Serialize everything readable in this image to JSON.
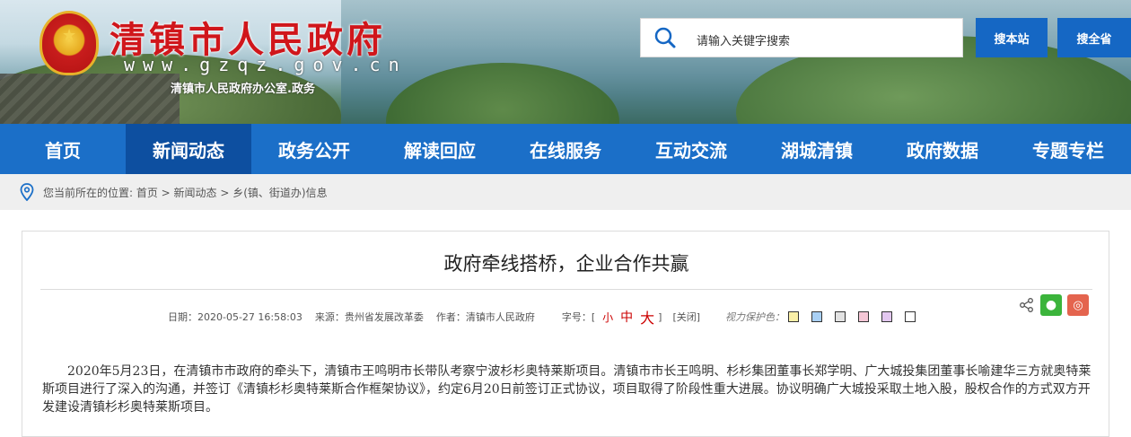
{
  "header": {
    "site_title": "清镇市人民政府",
    "site_domain": "www.gzqz.gov.cn",
    "site_org": "清镇市人民政府办公室.政务",
    "search_placeholder": "请输入关键字搜索",
    "search_station_label": "搜本站",
    "search_all_label": "搜全省"
  },
  "nav": {
    "items": [
      {
        "label": "首页"
      },
      {
        "label": "新闻动态"
      },
      {
        "label": "政务公开"
      },
      {
        "label": "解读回应"
      },
      {
        "label": "在线服务"
      },
      {
        "label": "互动交流"
      },
      {
        "label": "湖城清镇"
      },
      {
        "label": "政府数据"
      },
      {
        "label": "专题专栏"
      }
    ],
    "active_index": 1
  },
  "breadcrumb": {
    "text": "您当前所在的位置: 首页 > 新闻动态 > 乡(镇、街道办)信息"
  },
  "article": {
    "title": "政府牵线搭桥，企业合作共赢",
    "date": "日期：2020-05-27 16:58:03",
    "source": "来源：贵州省发展改革委",
    "author": "作者：清镇市人民政府",
    "font_size_label": "字号：[",
    "font_small": "小",
    "font_mid": "中",
    "font_big": "大",
    "font_close": "]",
    "close_label": "[关闭]",
    "eye_protect_label": "视力保护色：",
    "swatches": [
      "#fbf0a8",
      "#a9d0f5",
      "#e2e2e2",
      "#f5c7d6",
      "#e3c8f0",
      "#ffffff"
    ],
    "body": "2020年5月23日，在清镇市市政府的牵头下，清镇市王鸣明市长带队考察宁波杉杉奥特莱斯项目。清镇市市长王鸣明、杉杉集团董事长郑学明、广大城投集团董事长喻建华三方就奥特莱斯项目进行了深入的沟通，并签订《清镇杉杉奥特莱斯合作框架协议》，约定6月20日前签订正式协议，项目取得了阶段性重大进展。协议明确广大城投采取土地入股，股权合作的方式双方开发建设清镇杉杉奥特莱斯项目。"
  },
  "colors": {
    "nav_bg": "#1b6fc8",
    "nav_active": "#0d4fa0",
    "title_red": "#d0161b",
    "button_blue": "#1567c4"
  }
}
